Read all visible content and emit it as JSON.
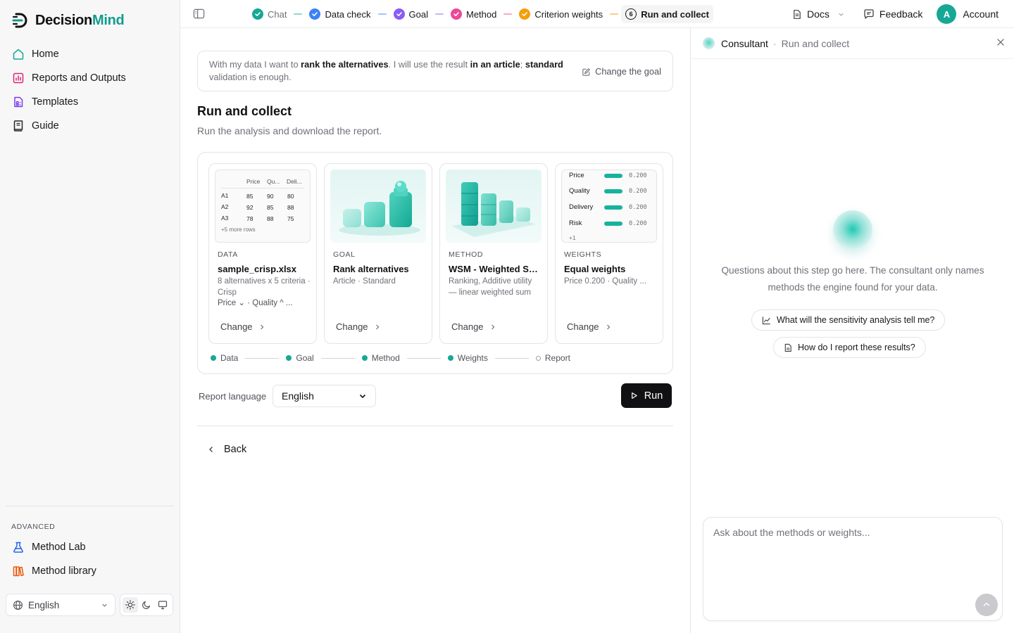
{
  "brand": {
    "name_main": "Decision",
    "name_accent": "Mind",
    "accent_color": "#119c8f"
  },
  "sidebar": {
    "items": [
      {
        "label": "Home",
        "icon": "home-icon"
      },
      {
        "label": "Reports and Outputs",
        "icon": "reports-icon"
      },
      {
        "label": "Templates",
        "icon": "templates-icon"
      },
      {
        "label": "Guide",
        "icon": "guide-icon"
      }
    ],
    "advanced_label": "ADVANCED",
    "advanced_items": [
      {
        "label": "Method Lab",
        "icon": "flask-icon"
      },
      {
        "label": "Method library",
        "icon": "library-icon"
      }
    ],
    "language": "English",
    "theme_modes": [
      "light",
      "dark",
      "system"
    ]
  },
  "topbar": {
    "steps": [
      {
        "label": "Chat",
        "status": "done",
        "color": "#17a895"
      },
      {
        "label": "Data check",
        "status": "done",
        "color": "#3b82f6"
      },
      {
        "label": "Goal",
        "status": "done",
        "color": "#8b5cf6"
      },
      {
        "label": "Method",
        "status": "done",
        "color": "#ec4899"
      },
      {
        "label": "Criterion weights",
        "status": "done",
        "color": "#f59e0b"
      },
      {
        "label": "Run and collect",
        "status": "current",
        "number": "6"
      }
    ],
    "docs": "Docs",
    "feedback": "Feedback",
    "avatar_letter": "A",
    "account": "Account"
  },
  "goal": {
    "p1": "With my data I want to ",
    "b1": "rank the alternatives",
    "p2": ". I will use the result ",
    "b2": "in an article",
    "p3": "; ",
    "b3": "standard",
    "p4": " validation is enough.",
    "change": "Change the goal"
  },
  "section": {
    "title": "Run and collect",
    "subtitle": "Run the analysis and download the report."
  },
  "cards": [
    {
      "category": "DATA",
      "title": "sample_crisp.xlsx",
      "desc1": "8 alternatives x 5 criteria · Crisp",
      "desc2": "Price ⌄ · Quality ^ ...",
      "change": "Change"
    },
    {
      "category": "GOAL",
      "title": "Rank alternatives",
      "desc1": "Article · Standard",
      "change": "Change"
    },
    {
      "category": "METHOD",
      "title": "WSM - Weighted Sum Model",
      "desc1": "Ranking, Additive utility — linear weighted sum",
      "change": "Change"
    },
    {
      "category": "WEIGHTS",
      "title": "Equal weights",
      "desc1": "Price 0.200 · Quality ...",
      "change": "Change"
    }
  ],
  "data_preview": {
    "headers": [
      "Price",
      "Qu...",
      "Deli..."
    ],
    "rows": [
      {
        "name": "A1",
        "values": [
          "85",
          "90",
          "80"
        ]
      },
      {
        "name": "A2",
        "values": [
          "92",
          "85",
          "88"
        ]
      },
      {
        "name": "A3",
        "values": [
          "78",
          "88",
          "75"
        ]
      }
    ],
    "more": "+5 more rows"
  },
  "weights_preview": {
    "rows": [
      {
        "label": "Price",
        "value": "0.200",
        "fraction": 0.2
      },
      {
        "label": "Quality",
        "value": "0.200",
        "fraction": 0.2
      },
      {
        "label": "Delivery",
        "value": "0.200",
        "fraction": 0.2
      },
      {
        "label": "Risk",
        "value": "0.200",
        "fraction": 0.2
      }
    ],
    "more": "+1"
  },
  "progress": [
    {
      "label": "Data",
      "done": true
    },
    {
      "label": "Goal",
      "done": true
    },
    {
      "label": "Method",
      "done": true
    },
    {
      "label": "Weights",
      "done": true
    },
    {
      "label": "Report",
      "done": false
    }
  ],
  "run": {
    "language_label": "Report language",
    "language": "English",
    "button": "Run"
  },
  "back": "Back",
  "consultant": {
    "title": "Consultant",
    "subtitle": "Run and collect",
    "message": "Questions about this step go here. The consultant only names methods the engine found for your data.",
    "suggestions": [
      "What will the sensitivity analysis tell me?",
      "How do I report these results?"
    ],
    "input_placeholder": "Ask about the methods or weights..."
  }
}
